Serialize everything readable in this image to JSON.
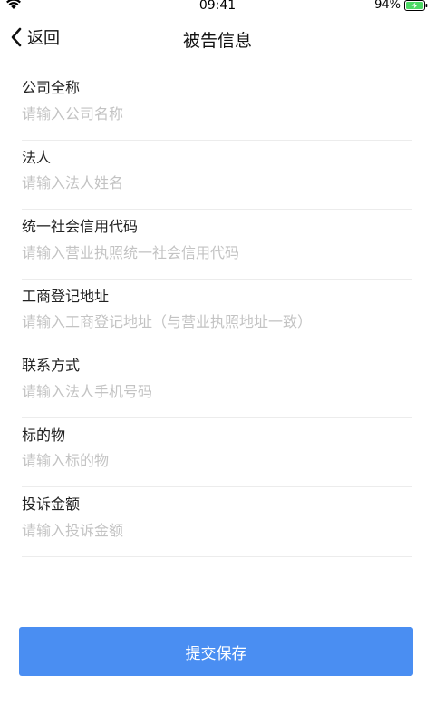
{
  "status": {
    "time": "09:41",
    "battery": "94%"
  },
  "nav": {
    "back_label": "返回",
    "title": "被告信息"
  },
  "form": {
    "fields": [
      {
        "label": "公司全称",
        "placeholder": "请输入公司名称",
        "value": ""
      },
      {
        "label": "法人",
        "placeholder": "请输入法人姓名",
        "value": ""
      },
      {
        "label": "统一社会信用代码",
        "placeholder": "请输入营业执照统一社会信用代码",
        "value": ""
      },
      {
        "label": "工商登记地址",
        "placeholder": "请输入工商登记地址（与营业执照地址一致）",
        "value": ""
      },
      {
        "label": "联系方式",
        "placeholder": "请输入法人手机号码",
        "value": ""
      },
      {
        "label": "标的物",
        "placeholder": "请输入标的物",
        "value": ""
      },
      {
        "label": "投诉金额",
        "placeholder": "请输入投诉金额",
        "value": ""
      }
    ]
  },
  "submit": {
    "label": "提交保存"
  },
  "colors": {
    "accent": "#4a8ef2",
    "battery_green": "#4cd964",
    "placeholder": "#c3c3c3",
    "divider": "#ececec"
  }
}
